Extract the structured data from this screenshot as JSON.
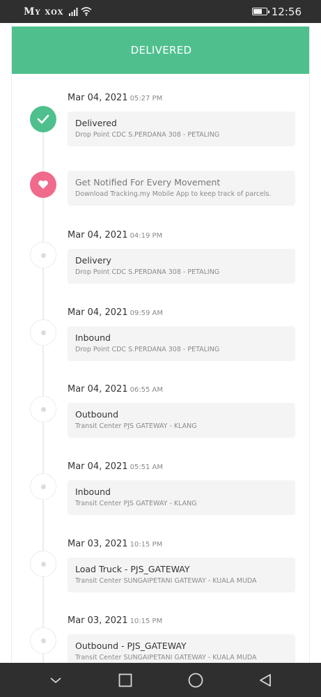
{
  "status_bar": {
    "carrier": "My xox",
    "time": "12:56"
  },
  "header": {
    "title": "DELIVERED"
  },
  "events": [
    {
      "date": "Mar 04, 2021",
      "time": "05:27 PM",
      "status": "Delivered",
      "location": "Drop Point CDC S.PERDANA 308 - PETALING",
      "icon": "check-icon"
    },
    {
      "date": "",
      "time": "",
      "status": "Get Notified For Every Movement",
      "location": "Download Tracking.my Mobile App to keep track of parcels.",
      "icon": "heart-icon"
    },
    {
      "date": "Mar 04, 2021",
      "time": "04:19 PM",
      "status": "Delivery",
      "location": "Drop Point CDC S.PERDANA 308 - PETALING",
      "icon": "dot-icon"
    },
    {
      "date": "Mar 04, 2021",
      "time": "09:59 AM",
      "status": "Inbound",
      "location": "Drop Point CDC S.PERDANA 308 - PETALING",
      "icon": "dot-icon"
    },
    {
      "date": "Mar 04, 2021",
      "time": "06:55 AM",
      "status": "Outbound",
      "location": "Transit Center PJS GATEWAY - KLANG",
      "icon": "dot-icon"
    },
    {
      "date": "Mar 04, 2021",
      "time": "05:51 AM",
      "status": "Inbound",
      "location": "Transit Center PJS GATEWAY - KLANG",
      "icon": "dot-icon"
    },
    {
      "date": "Mar 03, 2021",
      "time": "10:15 PM",
      "status": "Load Truck - PJS_GATEWAY",
      "location": "Transit Center SUNGAIPETANI GATEWAY - KUALA MUDA",
      "icon": "dot-icon"
    },
    {
      "date": "Mar 03, 2021",
      "time": "10:15 PM",
      "status": "Outbound - PJS_GATEWAY",
      "location": "Transit Center SUNGAIPETANI GATEWAY - KUALA MUDA",
      "icon": "dot-icon"
    }
  ],
  "nav_bar": {
    "icons": [
      "chevron-down-icon",
      "recents-square-icon",
      "home-circle-icon",
      "back-triangle-icon"
    ]
  },
  "colors": {
    "accent_green": "#4fc08d",
    "accent_pink": "#f06a8c",
    "system_bar": "#2f2f2f"
  }
}
